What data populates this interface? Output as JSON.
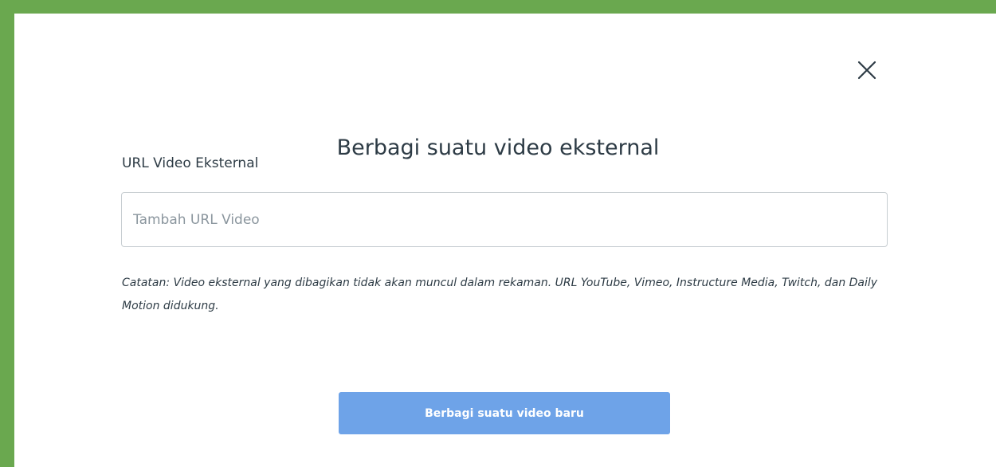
{
  "dialog": {
    "title": "Berbagi suatu video eksternal",
    "close_icon": "close-icon",
    "close_label": "Tutup",
    "field_label": "URL Video Eksternal",
    "input": {
      "value": "",
      "placeholder": "Tambah URL Video"
    },
    "note": "Catatan: Video eksternal yang dibagikan tidak akan muncul dalam rekaman. URL YouTube, Vimeo, Instructure Media, Twitch, dan Daily Motion didukung.",
    "share_button_label": "Berbagi suatu video baru"
  },
  "colors": {
    "frame_border": "#6aa84f",
    "text_primary": "#2d3b45",
    "button_background": "#6ea3e8",
    "button_text": "#ffffff",
    "input_border": "#c7cdd1",
    "placeholder": "#8b969e"
  }
}
